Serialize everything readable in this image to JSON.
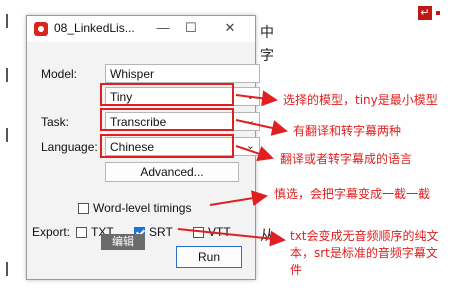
{
  "window": {
    "title": "08_LinkedLis...",
    "minimize": "—",
    "maximize": "☐",
    "close": "✕"
  },
  "form": {
    "model_label": "Model:",
    "model_value": "Whisper",
    "size_value": "Tiny",
    "task_label": "Task:",
    "task_value": "Transcribe",
    "language_label": "Language:",
    "language_value": "Chinese",
    "advanced_label": "Advanced...",
    "word_timings_label": "Word-level timings",
    "word_timings_checked": false,
    "export_label": "Export:",
    "export_txt": "TXT",
    "export_txt_checked": false,
    "export_srt": "SRT",
    "export_srt_checked": true,
    "export_vtt": "VTT",
    "export_vtt_checked": false,
    "tooltip": "编辑",
    "run_label": "Run"
  },
  "annotations": {
    "model": "选择的模型，tiny是最小模型",
    "task": "有翻译和转字幕两种",
    "language": "翻译或者转字幕成的语言",
    "word_timings": "慎选，会把字幕变成一截一截",
    "export_line1": "txt会变成无音频顺序的纯文",
    "export_line2": "本，srt是标准的音频字幕文",
    "export_line3": "件"
  },
  "background": {
    "text_1": "中",
    "text_2": "字",
    "text_3": "从",
    "corner_icon": "↵"
  },
  "colors": {
    "annotation": "#e02020",
    "accent": "#1a73d9"
  }
}
